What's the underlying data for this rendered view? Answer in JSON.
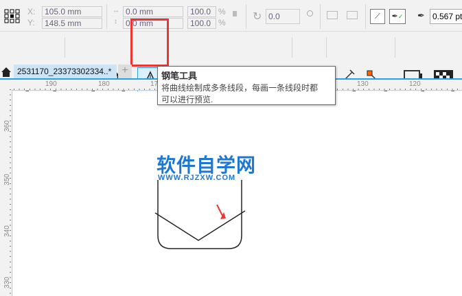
{
  "property_bar": {
    "x_label": "X:",
    "y_label": "Y:",
    "x_value": "105.0 mm",
    "y_value": "148.5 mm",
    "width_value": "0.0 mm",
    "height_value": "0.0 mm",
    "scale_x": "100.0",
    "scale_y": "100.0",
    "percent": "%",
    "rotation": "0.0",
    "outline_width": "0.567 pt"
  },
  "toolbox": [
    "pick-tool",
    "shape-tool",
    "crop-tool",
    "zoom-tool",
    "pen-tool",
    "artistic-media-tool",
    "rectangle-tool",
    "ellipse-tool",
    "polygon-tool",
    "text-tool",
    "dimension-tool",
    "connector-tool",
    "drop-shadow-tool",
    "transparency-tool"
  ],
  "tabs": {
    "document": "2531170_23373302334..*",
    "add": "+"
  },
  "tooltip": {
    "title": "钢笔工具",
    "line1": "将曲线绘制成多条线段，每画一条线段时都",
    "line2": "可以进行预览."
  },
  "ruler_h": [
    "190",
    "180",
    "170",
    "130",
    "120"
  ],
  "ruler_v": [
    "360",
    "350",
    "340",
    "330"
  ],
  "watermark": {
    "title": "软件自学网",
    "url": "WWW.RJZXW.COM"
  },
  "colors": {
    "highlight": "#e33",
    "accent": "#29a3e0",
    "watermark": "#1e78d2"
  }
}
